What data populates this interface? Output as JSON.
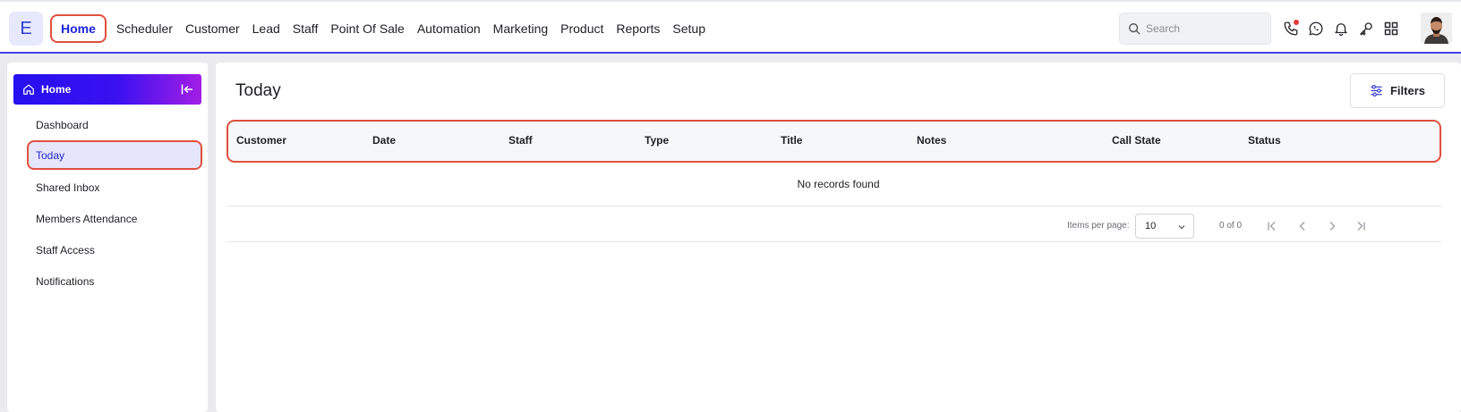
{
  "app": {
    "logo_letter": "E"
  },
  "nav": {
    "items": [
      "Home",
      "Scheduler",
      "Customer",
      "Lead",
      "Staff",
      "Point Of Sale",
      "Automation",
      "Marketing",
      "Product",
      "Reports",
      "Setup"
    ],
    "active": "Home"
  },
  "search": {
    "placeholder": "Search"
  },
  "top_icons": [
    "phone-icon",
    "whatsapp-icon",
    "bell-icon",
    "key-icon",
    "apps-grid-icon"
  ],
  "sidebar": {
    "header": "Home",
    "items": [
      "Dashboard",
      "Today",
      "Shared Inbox",
      "Members Attendance",
      "Staff Access",
      "Notifications"
    ],
    "active": "Today"
  },
  "main": {
    "title": "Today",
    "filters_label": "Filters",
    "columns": [
      "Customer",
      "Date",
      "Staff",
      "Type",
      "Title",
      "Notes",
      "Call State",
      "Status"
    ],
    "empty_message": "No records found",
    "pagination": {
      "items_per_page_label": "Items per page:",
      "page_size": "10",
      "range": "0 of 0"
    }
  },
  "colors": {
    "accent": "#2f2bea",
    "highlight_outline": "#e0503c",
    "notification_dot": "#e53935"
  }
}
